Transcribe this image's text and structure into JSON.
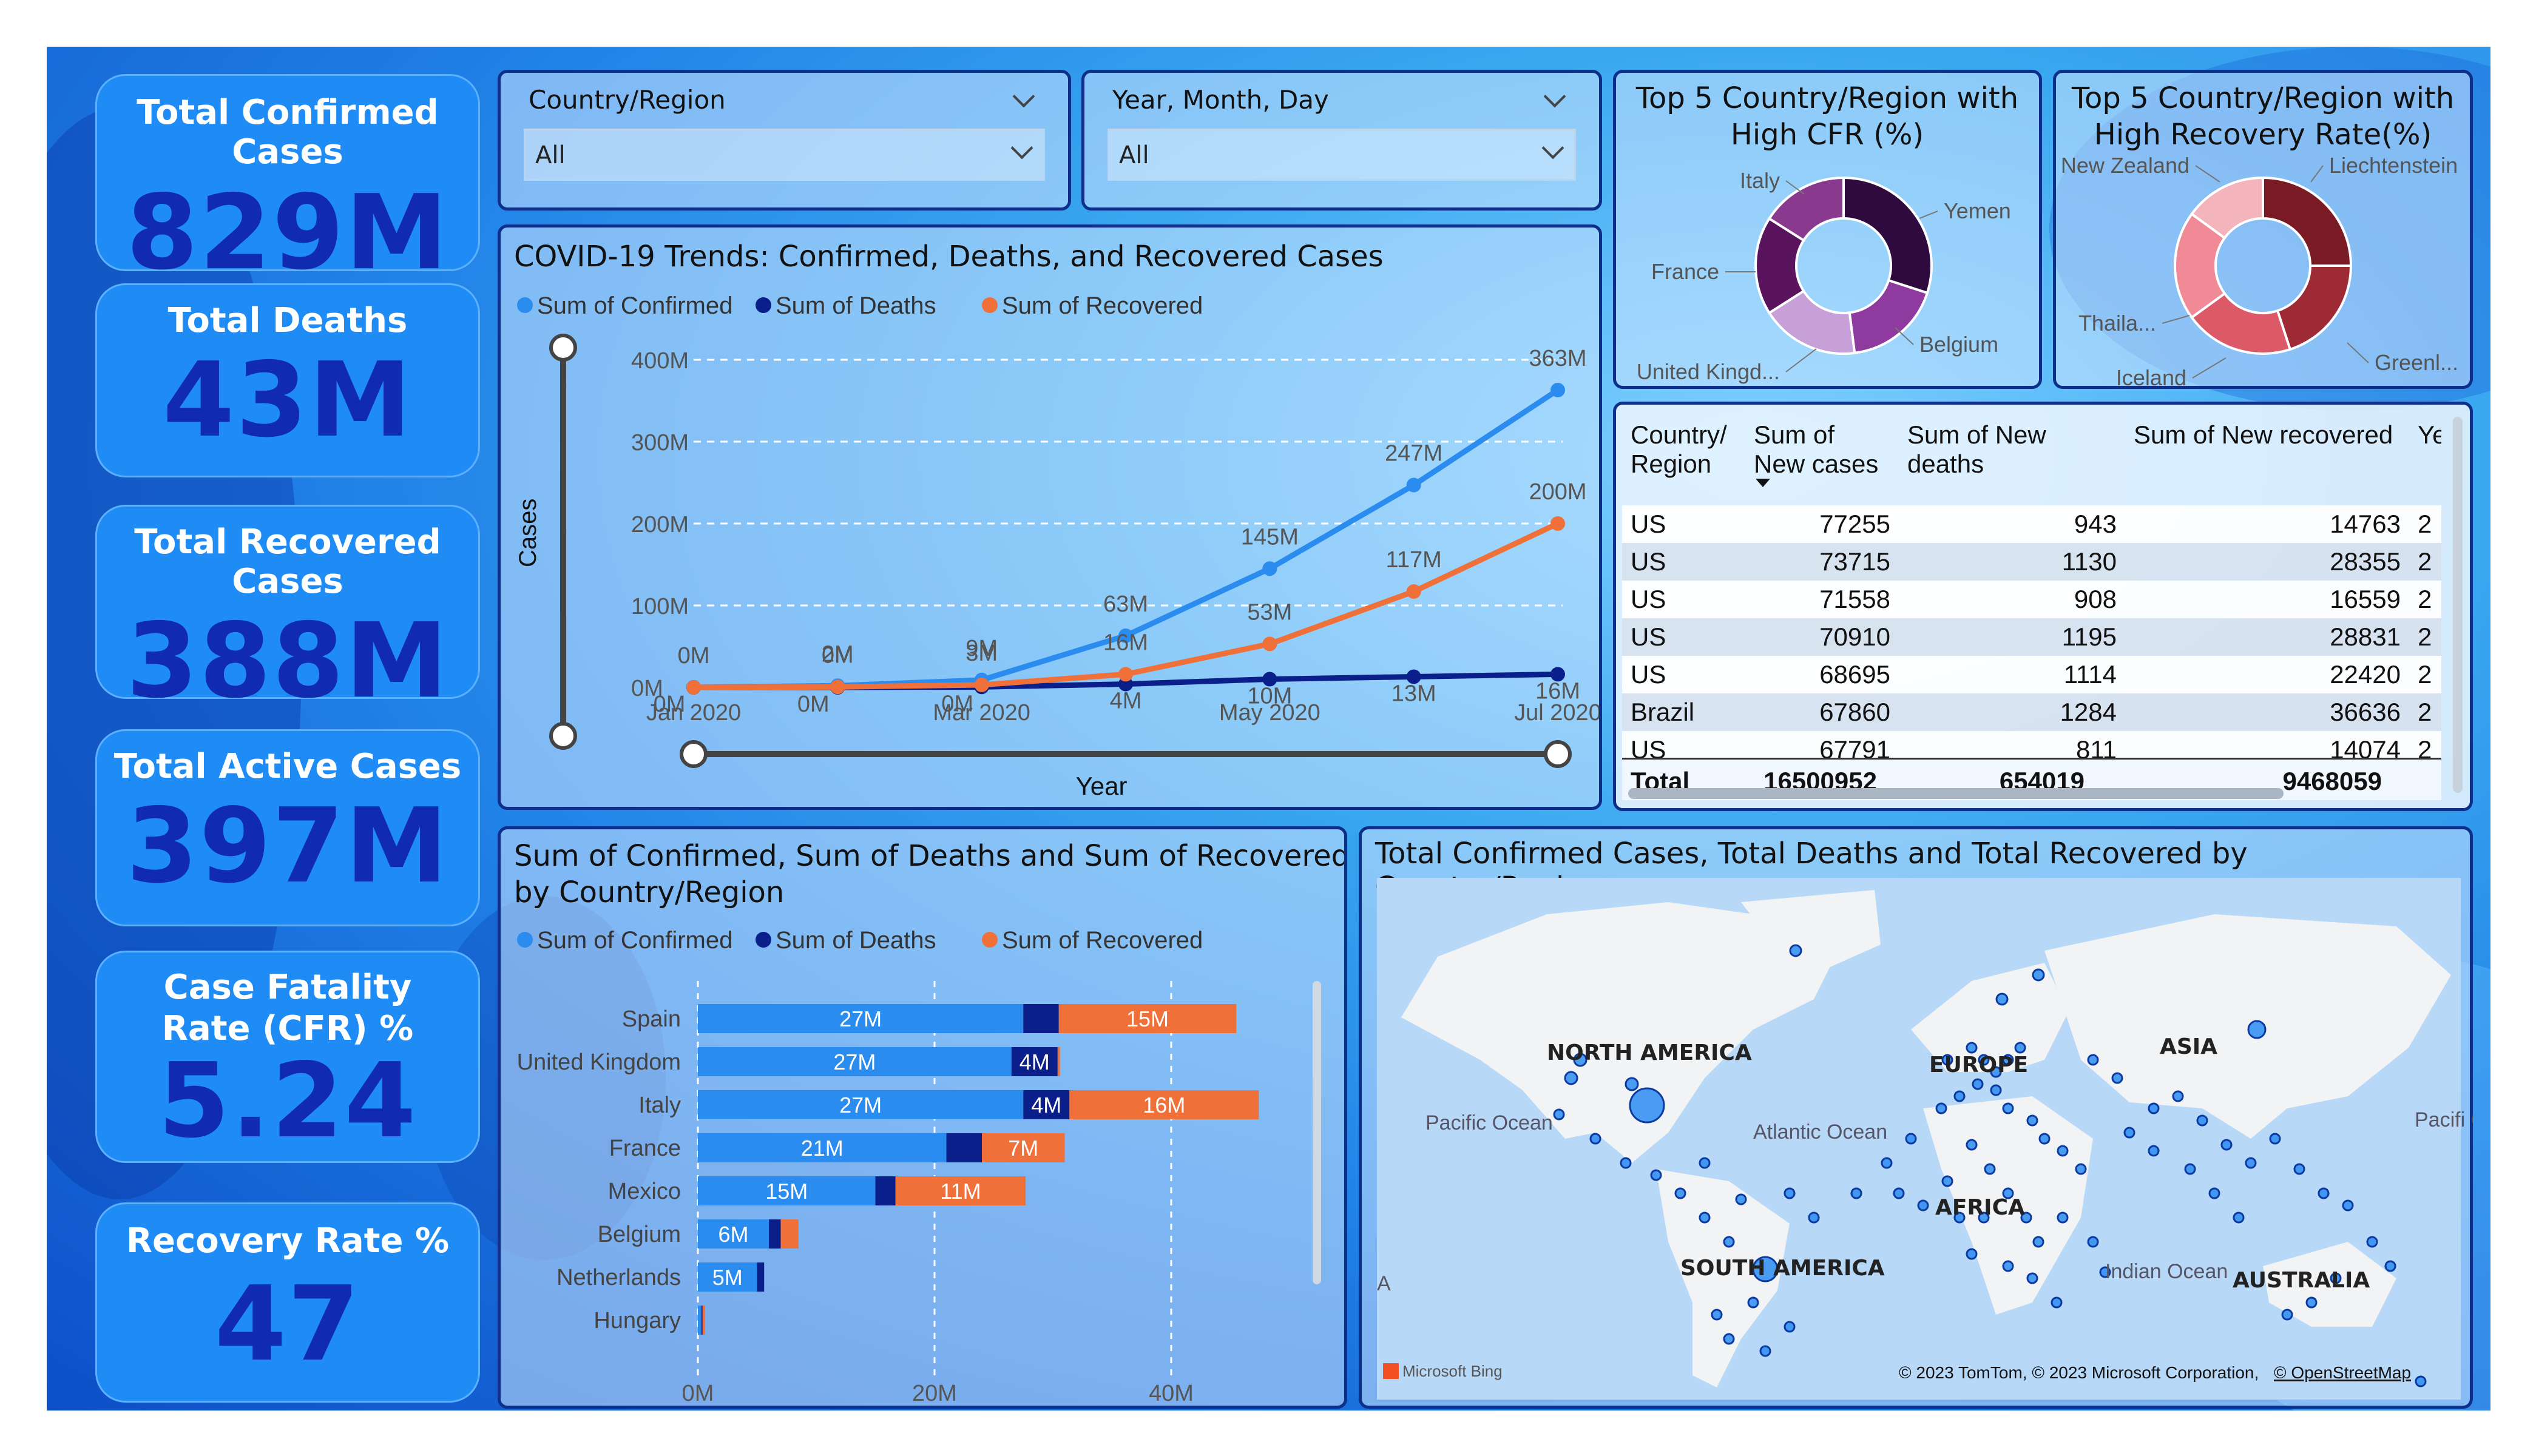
{
  "kpis": [
    {
      "label": "Total Confirmed Cases",
      "value": "829M"
    },
    {
      "label": "Total Deaths",
      "value": "43M"
    },
    {
      "label": "Total Recovered Cases",
      "value": "388M"
    },
    {
      "label": "Total Active Cases",
      "value": "397M"
    },
    {
      "label": "Case Fatality Rate (CFR) %",
      "value": "5.24"
    },
    {
      "label": "Recovery Rate %",
      "value": "47"
    }
  ],
  "slicers": [
    {
      "label": "Country/Region",
      "value": "All"
    },
    {
      "label": "Year, Month, Day",
      "value": "All"
    }
  ],
  "colors": {
    "confirmed": "#2b8cf0",
    "deaths": "#0b1f8a",
    "recovered": "#f0703a"
  },
  "trend": {
    "title": "COVID-19 Trends: Confirmed, Deaths, and Recovered Cases",
    "legend": [
      "Sum of Confirmed",
      "Sum of Deaths",
      "Sum of Recovered"
    ],
    "ylabel": "Cases",
    "xlabel": "Year",
    "yticks": [
      "400M",
      "300M",
      "200M",
      "100M",
      "0M"
    ],
    "xticks": [
      "Jan 2020",
      "Mar 2020",
      "May 2020",
      "Jul 2020"
    ]
  },
  "bars": {
    "title_line1": "Sum of Confirmed, Sum of Deaths and Sum of Recovered",
    "title_line2": "by Country/Region",
    "legend": [
      "Sum of Confirmed",
      "Sum of Deaths",
      "Sum of Recovered"
    ],
    "xticks": [
      "0M",
      "20M",
      "40M"
    ]
  },
  "donut1": {
    "title_line1": "Top 5 Country/Region with",
    "title_line2": "High CFR (%)",
    "labels": [
      "Yemen",
      "Belgium",
      "United Kingd...",
      "France",
      "Italy"
    ],
    "colors": [
      "#2e0a3e",
      "#8e3a9e",
      "#c8a0d8",
      "#5a145e",
      "#8a3a8e"
    ]
  },
  "donut2": {
    "title_line1": "Top 5 Country/Region with",
    "title_line2": "High Recovery Rate(%)",
    "labels": [
      "Liechtenstein",
      "Greenl...",
      "Iceland",
      "Thaila...",
      "New Zealand"
    ],
    "colors": [
      "#7a1a24",
      "#9e2a36",
      "#dc5a68",
      "#f08a96",
      "#f4b4bc"
    ]
  },
  "table": {
    "headers": [
      "Country/ Region",
      "Sum of New cases",
      "Sum of New deaths",
      "Sum of New recovered",
      "Ye"
    ],
    "rows": [
      [
        "US",
        "77255",
        "943",
        "14763",
        "2"
      ],
      [
        "US",
        "73715",
        "1130",
        "28355",
        "2"
      ],
      [
        "US",
        "71558",
        "908",
        "16559",
        "2"
      ],
      [
        "US",
        "70910",
        "1195",
        "28831",
        "2"
      ],
      [
        "US",
        "68695",
        "1114",
        "22420",
        "2"
      ],
      [
        "Brazil",
        "67860",
        "1284",
        "36636",
        "2"
      ],
      [
        "US",
        "67791",
        "811",
        "14074",
        "2"
      ]
    ],
    "total": [
      "Total",
      "16500952",
      "654019",
      "9468059"
    ]
  },
  "map": {
    "title": "Total Confirmed Cases, Total Deaths and Total Recovered by Country/Region",
    "labels": [
      "NORTH AMERICA",
      "SOUTH AMERICA",
      "EUROPE",
      "AFRICA",
      "ASIA",
      "AUSTRALIA",
      "Pacific Ocean",
      "Atlantic Ocean",
      "Indian Ocean",
      "Pacifi Ocea",
      "A"
    ],
    "credit": "© 2023 TomTom, © 2023 Microsoft Corporation,",
    "credit_link": "© OpenStreetMap",
    "logo": "Microsoft Bing"
  },
  "chart_data": [
    {
      "type": "line",
      "title": "COVID-19 Trends: Confirmed, Deaths, and Recovered Cases",
      "xlabel": "Year",
      "ylabel": "Cases",
      "ylim": [
        0,
        400
      ],
      "x": [
        "Jan 2020",
        "Feb 2020",
        "Mar 2020",
        "Apr 2020",
        "May 2020",
        "Jun 2020",
        "Jul 2020"
      ],
      "series": [
        {
          "name": "Sum of Confirmed",
          "values": [
            0,
            2,
            9,
            63,
            145,
            247,
            363
          ],
          "labels": [
            "0M",
            "2M",
            "9M",
            "63M",
            "145M",
            "247M",
            "363M"
          ]
        },
        {
          "name": "Sum of Deaths",
          "values": [
            0,
            0,
            0.5,
            4,
            10,
            13,
            16
          ],
          "labels": [
            "0M",
            "0M",
            "0M",
            "4M",
            "10M",
            "13M",
            "16M"
          ]
        },
        {
          "name": "Sum of Recovered",
          "values": [
            0,
            0.5,
            3,
            16,
            53,
            117,
            200
          ],
          "labels": [
            "0M",
            "0M",
            "3M",
            "16M",
            "53M",
            "117M",
            "200M"
          ]
        }
      ],
      "grid": true,
      "legend": "top-left"
    },
    {
      "type": "bar",
      "title": "Sum of Confirmed, Sum of Deaths and Sum of Recovered by Country/Region",
      "categories": [
        "Spain",
        "United Kingdom",
        "Italy",
        "France",
        "Mexico",
        "Belgium",
        "Netherlands",
        "Hungary"
      ],
      "series": [
        {
          "name": "Sum of Confirmed",
          "values": [
            27.5,
            26.5,
            27.5,
            21,
            15,
            6,
            5,
            0.3
          ],
          "labels": [
            "27M",
            "27M",
            "27M",
            "21M",
            "15M",
            "6M",
            "5M",
            ""
          ]
        },
        {
          "name": "Sum of Deaths",
          "values": [
            3,
            3.9,
            3.9,
            3,
            1.7,
            1,
            0.6,
            0.1
          ],
          "labels": [
            "",
            "4M",
            "4M",
            "",
            "",
            "",
            "",
            ""
          ]
        },
        {
          "name": "Sum of Recovered",
          "values": [
            15,
            0.2,
            16,
            7,
            11,
            1.5,
            0,
            0.2
          ],
          "labels": [
            "15M",
            "",
            "16M",
            "7M",
            "11M",
            "",
            "",
            ""
          ]
        }
      ],
      "xlim": [
        0,
        50
      ],
      "orientation": "horizontal-stacked",
      "legend": "top-left"
    },
    {
      "type": "pie",
      "title": "Top 5 Country/Region with High CFR (%)",
      "categories": [
        "Yemen",
        "Belgium",
        "United Kingd...",
        "France",
        "Italy"
      ],
      "values": [
        30,
        18,
        18,
        18,
        16
      ]
    },
    {
      "type": "pie",
      "title": "Top 5 Country/Region with High Recovery Rate(%)",
      "categories": [
        "Liechtenstein",
        "Greenl...",
        "Iceland",
        "Thaila...",
        "New Zealand"
      ],
      "values": [
        25,
        20,
        20,
        20,
        15
      ]
    }
  ]
}
